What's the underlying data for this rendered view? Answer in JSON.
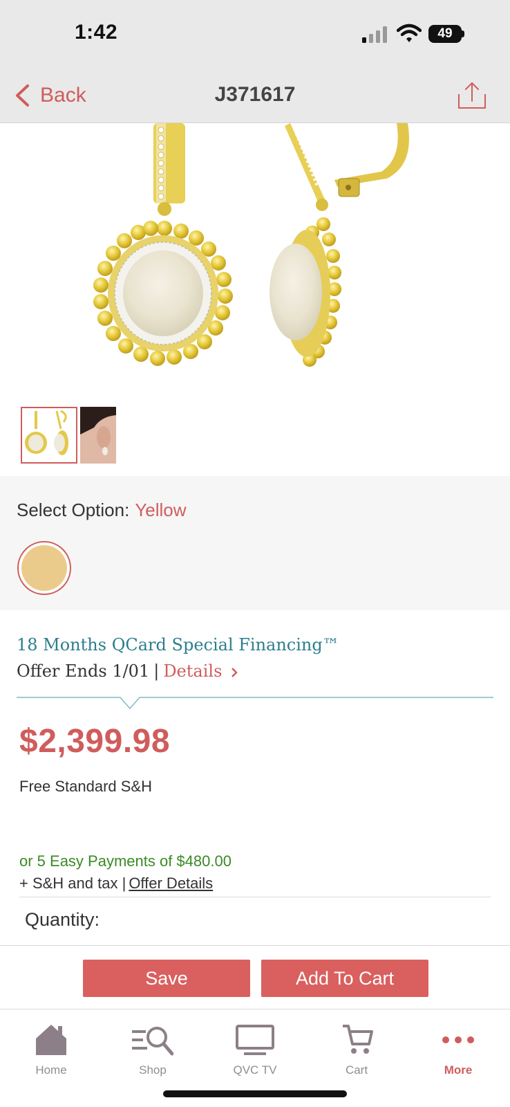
{
  "status_bar": {
    "time": "1:42",
    "battery": "49"
  },
  "nav": {
    "back_label": "Back",
    "title": "J371617"
  },
  "colors": {
    "accent": "#d05c5c",
    "teal": "#2c7e8d",
    "green": "#3a8a25",
    "swatch": "#ebcb8c"
  },
  "options": {
    "label": "Select Option:",
    "selected": "Yellow"
  },
  "financing": {
    "title": "18 Months QCard Special Financing™",
    "offer_ends": "Offer Ends 1/01",
    "separator": "|",
    "details_label": "Details"
  },
  "price": {
    "amount": "$2,399.98",
    "shipping": "Free Standard S&H",
    "easy_pay": "or 5 Easy Payments of $480.00",
    "sh_tax": "+ S&H and tax  |",
    "offer_details": "Offer Details"
  },
  "quantity_label": "Quantity:",
  "actions": {
    "save": "Save",
    "add_to_cart": "Add To Cart"
  },
  "tabs": [
    {
      "label": "Home",
      "icon": "home-icon"
    },
    {
      "label": "Shop",
      "icon": "shop-search-icon"
    },
    {
      "label": "QVC TV",
      "icon": "tv-icon"
    },
    {
      "label": "Cart",
      "icon": "cart-icon"
    },
    {
      "label": "More",
      "icon": "more-icon"
    }
  ]
}
